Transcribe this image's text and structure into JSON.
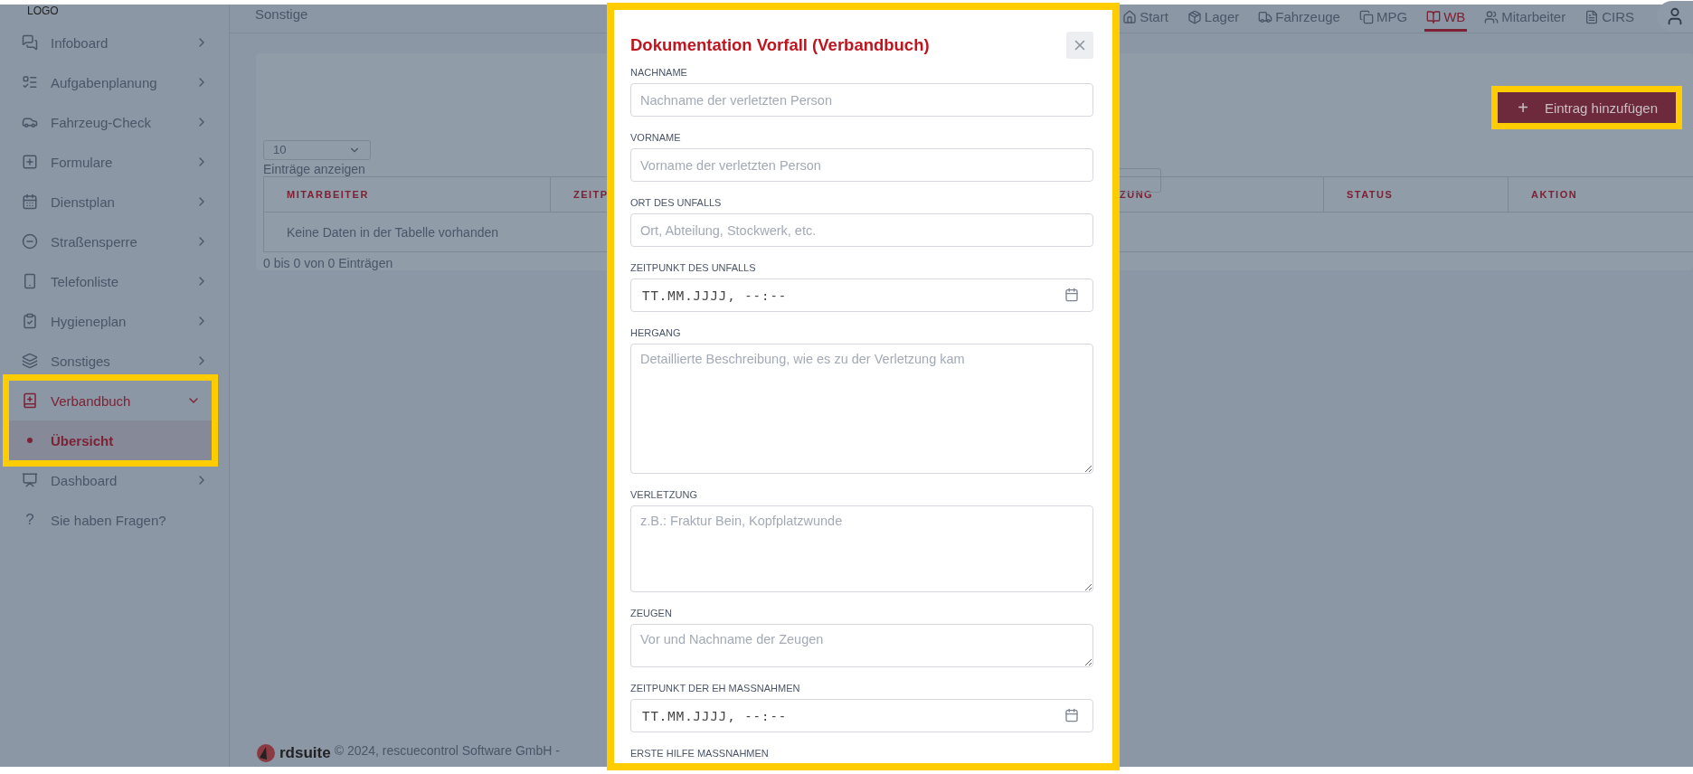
{
  "sidebar": {
    "logo": "LOGO",
    "items": [
      {
        "kind": "menu",
        "label": "Infoboard",
        "selected": false,
        "expanded": false
      },
      {
        "kind": "menu",
        "label": "Aufgabenplanung",
        "selected": false,
        "expanded": false
      },
      {
        "kind": "menu",
        "label": "Fahrzeug-Check",
        "selected": false,
        "expanded": false
      },
      {
        "kind": "menu",
        "label": "Formulare",
        "selected": false,
        "expanded": false
      },
      {
        "kind": "menu",
        "label": "Dienstplan",
        "selected": false,
        "expanded": false
      },
      {
        "kind": "menu",
        "label": "Straßensperre",
        "selected": false,
        "expanded": false
      },
      {
        "kind": "menu",
        "label": "Telefonliste",
        "selected": false,
        "expanded": false
      },
      {
        "kind": "menu",
        "label": "Hygieneplan",
        "selected": false,
        "expanded": false
      },
      {
        "kind": "menu",
        "label": "Sonstiges",
        "selected": false,
        "expanded": false
      },
      {
        "kind": "menu",
        "label": "Verbandbuch",
        "selected": true,
        "expanded": true,
        "highlighted": true,
        "children": [
          {
            "label": "Übersicht",
            "selected": true
          }
        ]
      },
      {
        "kind": "menu",
        "label": "Dashboard",
        "selected": false,
        "expanded": false
      },
      {
        "kind": "help",
        "icon_char": "?",
        "label": "Sie haben Fragen?",
        "selected": false
      }
    ]
  },
  "page_title": "Sonstige",
  "nav_tabs": [
    {
      "label": "Start",
      "selected": false
    },
    {
      "label": "Lager",
      "selected": false
    },
    {
      "label": "Fahrzeuge",
      "selected": false
    },
    {
      "label": "MPG",
      "selected": false
    },
    {
      "label": "WB",
      "selected": true
    },
    {
      "label": "Mitarbeiter",
      "selected": false
    },
    {
      "label": "CIRS",
      "selected": false
    }
  ],
  "add_button": {
    "label": "Eintrag hinzufügen",
    "icon_char": "+",
    "highlighted": true
  },
  "page_size": {
    "value": "10",
    "label": "Einträge anzeigen"
  },
  "table": {
    "columns": [
      "MITARBEITER",
      "ZEITP",
      "ZUNG",
      "STATUS",
      "AKTION"
    ],
    "empty_message": "Keine Daten in der Tabelle vorhanden",
    "info": "0 bis 0 von 0 Einträgen"
  },
  "footer": {
    "brand": "rdsuite",
    "text": "© 2024, rescuecontrol Software GmbH -"
  },
  "modal": {
    "title": "Dokumentation Vorfall (Verbandbuch)",
    "highlighted": true,
    "fields": [
      {
        "kind": "input",
        "label": "NACHNAME",
        "placeholder": "Nachname der verletzten Person"
      },
      {
        "kind": "input",
        "label": "VORNAME",
        "placeholder": "Vorname der verletzten Person"
      },
      {
        "kind": "input",
        "label": "ORT DES UNFALLS",
        "placeholder": "Ort, Abteilung, Stockwerk, etc."
      },
      {
        "kind": "datetime",
        "label": "ZEITPUNKT DES UNFALLS",
        "placeholder": "TT.MM.JJJJ, --:--"
      },
      {
        "kind": "textarea",
        "label": "HERGANG",
        "placeholder": "Detaillierte Beschreibung, wie es zu der Verletzung kam"
      },
      {
        "kind": "textarea",
        "label": "VERLETZUNG",
        "placeholder": "z.B.: Fraktur Bein, Kopfplatzwunde"
      },
      {
        "kind": "textarea",
        "label": "ZEUGEN",
        "placeholder": "Vor und Nachname der Zeugen"
      },
      {
        "kind": "datetime",
        "label": "ZEITPUNKT DER EH MASSNAHMEN",
        "placeholder": "TT.MM.JJJJ, --:--"
      },
      {
        "kind": "label",
        "label": "ERSTE HILFE MASSNAHMEN"
      }
    ]
  }
}
